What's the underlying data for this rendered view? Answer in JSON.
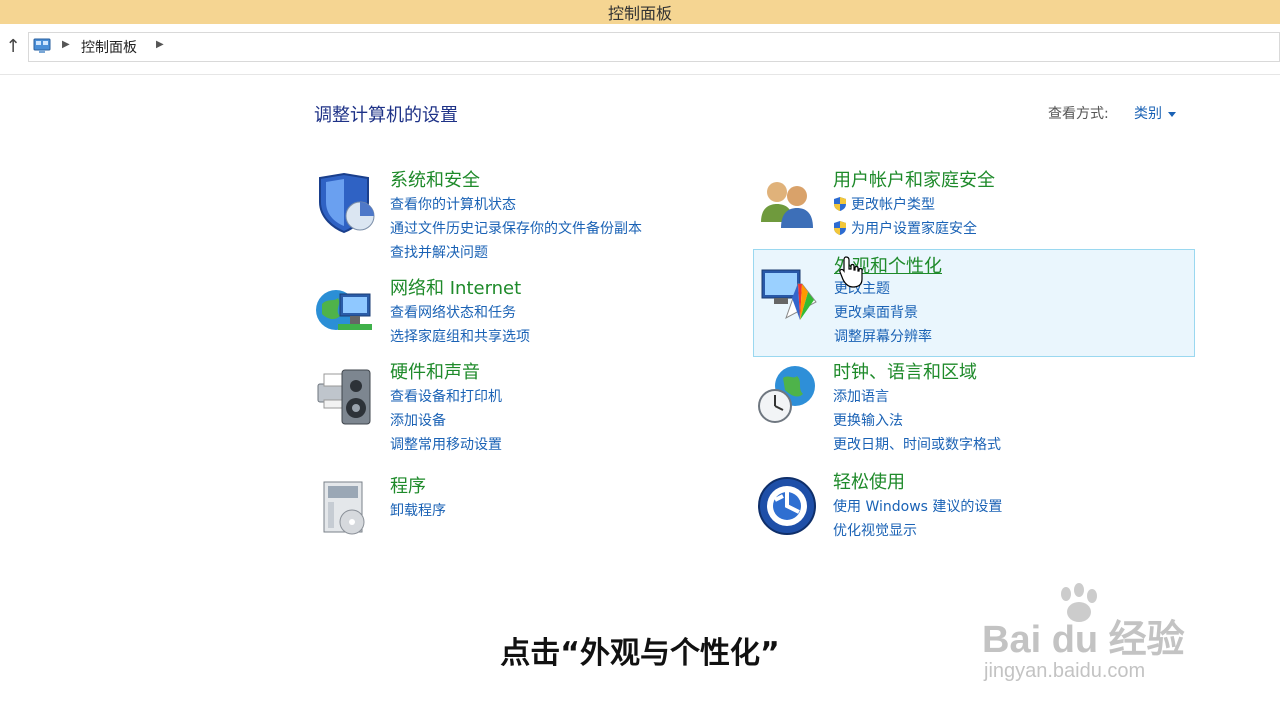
{
  "window": {
    "title": "控制面板"
  },
  "address": {
    "path": "控制面板"
  },
  "header": {
    "title": "调整计算机的设置",
    "view_label": "查看方式:",
    "view_value": "类别"
  },
  "categories": [
    {
      "title": "系统和安全",
      "links": [
        "查看你的计算机状态",
        "通过文件历史记录保存你的文件备份副本",
        "查找并解决问题"
      ]
    },
    {
      "title": "网络和 Internet",
      "links": [
        "查看网络状态和任务",
        "选择家庭组和共享选项"
      ]
    },
    {
      "title": "硬件和声音",
      "links": [
        "查看设备和打印机",
        "添加设备",
        "调整常用移动设置"
      ]
    },
    {
      "title": "程序",
      "links": [
        "卸载程序"
      ]
    },
    {
      "title": "用户帐户和家庭安全",
      "links": [
        "更改帐户类型",
        "为用户设置家庭安全"
      ]
    },
    {
      "title": "外观和个性化",
      "links": [
        "更改主题",
        "更改桌面背景",
        "调整屏幕分辨率"
      ]
    },
    {
      "title": "时钟、语言和区域",
      "links": [
        "添加语言",
        "更换输入法",
        "更改日期、时间或数字格式"
      ]
    },
    {
      "title": "轻松使用",
      "links": [
        "使用 Windows 建议的设置",
        "优化视觉显示"
      ]
    }
  ],
  "subtitle": "点击“外观与个性化”",
  "watermark": {
    "brand": "Bai du 经验",
    "url": "jingyan.baidu.com"
  },
  "colors": {
    "title_bar": "#f5d592",
    "category_title": "#1e8a2a",
    "link": "#1a62b5",
    "page_title": "#1e3287",
    "highlight": "#eaf6fd"
  }
}
